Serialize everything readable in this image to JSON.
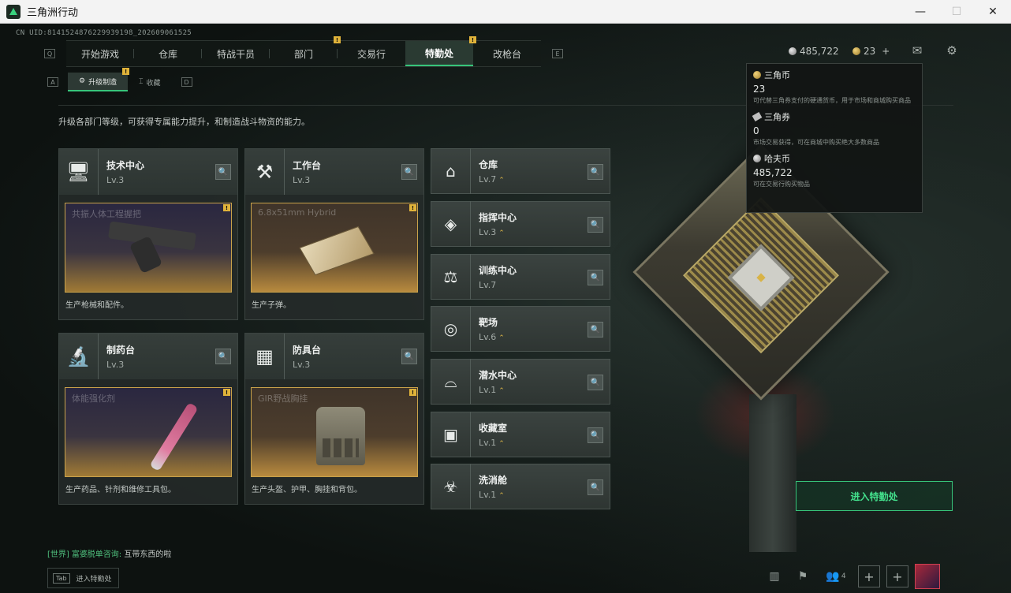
{
  "window": {
    "title": "三角洲行动",
    "min": "—",
    "max": "☐",
    "close": "✕"
  },
  "uid": "CN UID:8141524876229939198_202609061525",
  "nav": {
    "left_key": "Q",
    "right_key": "E",
    "tabs": [
      {
        "label": "开始游戏"
      },
      {
        "label": "仓库"
      },
      {
        "label": "特战干员"
      },
      {
        "label": "部门",
        "badge": "!"
      },
      {
        "label": "交易行"
      },
      {
        "label": "特勤处",
        "badge": "!"
      },
      {
        "label": "改枪台"
      }
    ]
  },
  "subnav": {
    "left_key": "A",
    "right_key": "D",
    "tabs": [
      {
        "label": "升级制造",
        "badge": "!"
      },
      {
        "label": "收藏"
      }
    ]
  },
  "description": "升级各部门等级，可获得专属能力提升，和制造战斗物资的能力。",
  "currency": {
    "silver": "485,722",
    "gold": "23",
    "add": "+"
  },
  "tooltip": [
    {
      "name": "三角币",
      "value": "23",
      "desc": "可代替三角券支付的硬通货币，用于市场和商城购买商品"
    },
    {
      "name": "三角券",
      "value": "0",
      "desc": "市场交易获得，可在商城中购买绝大多数商品"
    },
    {
      "name": "哈夫币",
      "value": "485,722",
      "desc": "可在交易行购买物品"
    }
  ],
  "cards": [
    {
      "name": "技术中心",
      "level": "Lv.3",
      "product": "共振人体工程握把",
      "footer": "生产枪械和配件。",
      "badge": "!"
    },
    {
      "name": "工作台",
      "level": "Lv.3",
      "product": "6.8x51mm Hybrid",
      "footer": "生产子弹。",
      "badge": "!"
    },
    {
      "name": "制药台",
      "level": "Lv.3",
      "product": "体能强化剂",
      "footer": "生产药品、针剂和维修工具包。",
      "badge": "!"
    },
    {
      "name": "防具台",
      "level": "Lv.3",
      "product": "GIR野战胸挂",
      "footer": "生产头盔、护甲、胸挂和背包。",
      "badge": "!"
    }
  ],
  "facilities": [
    {
      "name": "仓库",
      "level": "Lv.7"
    },
    {
      "name": "指挥中心",
      "level": "Lv.3"
    },
    {
      "name": "训练中心",
      "level": "Lv.7"
    },
    {
      "name": "靶场",
      "level": "Lv.6"
    },
    {
      "name": "潜水中心",
      "level": "Lv.1"
    },
    {
      "name": "收藏室",
      "level": "Lv.1"
    },
    {
      "name": "洗消舱",
      "level": "Lv.1"
    }
  ],
  "enter_button": "进入特勤处",
  "chat": {
    "channel": "[世界]",
    "user": "富婆脱单咨询:",
    "message": "互带东西的啦"
  },
  "tab_hint": {
    "key": "Tab",
    "label": "进入特勤处"
  },
  "bottom": {
    "friends": "4"
  },
  "colors": {
    "accent": "#37c47a",
    "badge": "#e0b33a",
    "product_border": "#c9a24a"
  }
}
